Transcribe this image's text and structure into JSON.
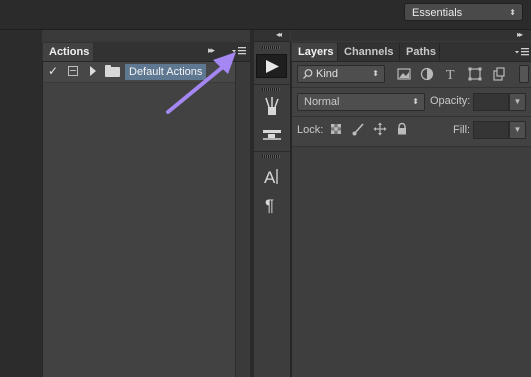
{
  "topbar": {
    "workspace": "Essentials",
    "workspace_chevron": "⬍"
  },
  "actions_panel": {
    "tab_label": "Actions",
    "collapse_glyph": "▸▸",
    "row": {
      "checked_glyph": "✓",
      "set_name": "Default Actions"
    }
  },
  "tool_strip": {
    "collapse_glyph": "◂◂",
    "play_icon": "play-icon",
    "icons": [
      "brush-presets-icon",
      "clone-source-icon",
      "character-icon",
      "paragraph-icon"
    ]
  },
  "layers_panel": {
    "collapse_glyph": "▸▸",
    "tabs": [
      "Layers",
      "Channels",
      "Paths"
    ],
    "filter_kind": "Kind",
    "filter_icons": [
      "pixel-filter-icon",
      "adjustment-filter-icon",
      "type-filter-icon",
      "shape-filter-icon",
      "smart-object-filter-icon"
    ],
    "blend_mode": "Normal",
    "opacity_label": "Opacity:",
    "opacity_value": "",
    "lock_label": "Lock:",
    "lock_icons": [
      "lock-transparent-icon",
      "lock-image-icon",
      "lock-position-icon",
      "lock-all-icon"
    ],
    "fill_label": "Fill:",
    "fill_value": ""
  },
  "annotation": {
    "arrow_color": "#a487f2",
    "arrow_target": "actions-panel-menu"
  }
}
